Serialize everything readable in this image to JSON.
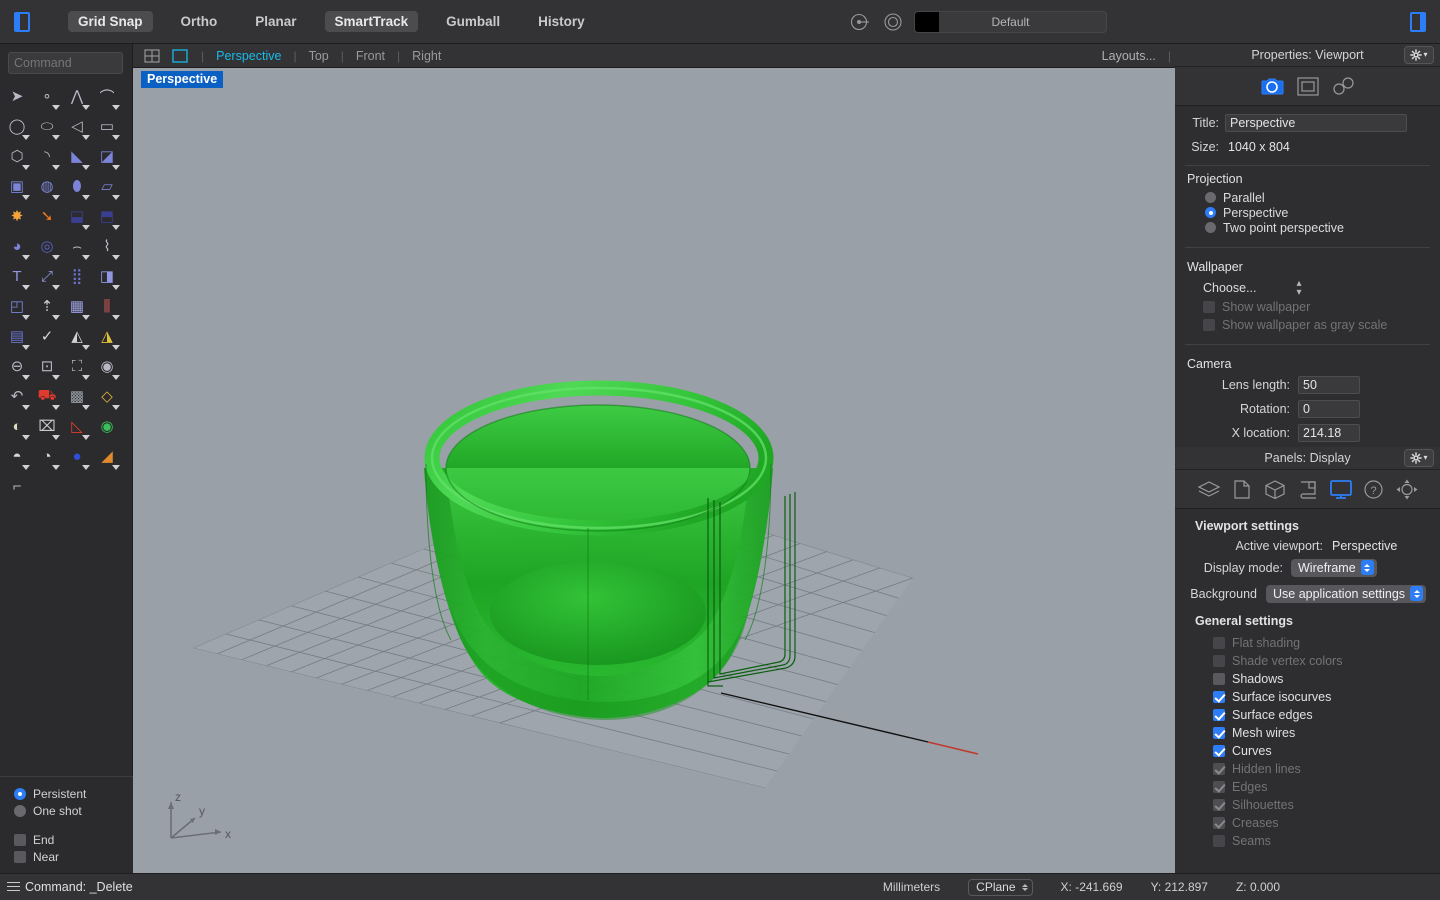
{
  "topbar": {
    "left_panel_toggle_icon": "left-panel-toggle-icon",
    "right_panel_toggle_icon": "right-panel-toggle-icon",
    "toggles": [
      {
        "label": "Grid Snap",
        "active": true
      },
      {
        "label": "Ortho",
        "active": false
      },
      {
        "label": "Planar",
        "active": false
      },
      {
        "label": "SmartTrack",
        "active": true
      },
      {
        "label": "Gumball",
        "active": false
      },
      {
        "label": "History",
        "active": false
      }
    ],
    "layer_icon": "layer-icon",
    "target-icon": "target-icon",
    "layer_color_hex": "#000000",
    "layer_name": "Default"
  },
  "command": {
    "placeholder": "Command"
  },
  "left_toolbar": {
    "tools": [
      "select-arrow-icon",
      "point-icon",
      "polyline-icon",
      "arc-icon",
      "circle-icon",
      "ellipse-icon",
      "curve-icon",
      "rectangle-icon",
      "polygon-icon",
      "fillet-curve-icon",
      "surface-corner-icon",
      "surface-edge-icon",
      "box-icon",
      "sphere-icon",
      "cylinder-icon",
      "surface-plane-icon",
      "explode-icon",
      "boolean-arrow-icon",
      "extrude-offset-icon",
      "extrude-straight-icon",
      "boolean-union-icon",
      "boolean-difference-icon",
      "blend-curve-icon",
      "array-curve-icon",
      "text-icon",
      "scale-icon",
      "array-icon",
      "mirror-icon",
      "solid-edit-icon",
      "point-array-icon",
      "grid-array-icon",
      "gumball-icon",
      "book-icon",
      "check-icon",
      "mesh-icon",
      "paint-icon",
      "zoom-out-icon",
      "zoom-window-icon",
      "zoom-extents-icon",
      "zoom-selected-icon",
      "undo-view-icon",
      "car-icon",
      "cplane-icon",
      "select-objects-icon",
      "light-icon",
      "lock-icon",
      "layers-icon",
      "color-wheel-icon",
      "render-icon",
      "render-grid-icon",
      "render-blue-icon",
      "render-cone-icon",
      "dimension-icon"
    ]
  },
  "osnap": {
    "modes": [
      {
        "label": "Persistent",
        "selected": true
      },
      {
        "label": "One shot",
        "selected": false
      }
    ],
    "snaps": [
      {
        "label": "End",
        "checked": false
      },
      {
        "label": "Near",
        "checked": false
      }
    ]
  },
  "viewport_tabs": {
    "four_view_icon": "four-view-icon",
    "single_view_icon": "single-view-icon",
    "tabs": [
      {
        "label": "Perspective",
        "active": true
      },
      {
        "label": "Top",
        "active": false
      },
      {
        "label": "Front",
        "active": false
      },
      {
        "label": "Right",
        "active": false
      }
    ],
    "layouts_label": "Layouts..."
  },
  "viewport": {
    "title": "Perspective",
    "axis_labels": {
      "x": "x",
      "y": "y",
      "z": "z"
    },
    "model_description": "green-translucent-cup",
    "model_color_hex": "#1faa25",
    "background_hex": "#9aa0a8"
  },
  "properties_panel": {
    "header": "Properties: Viewport",
    "gear_icon": "gear-dropdown-icon",
    "tab_icons": [
      "camera-icon",
      "viewport-icon",
      "link-icon"
    ],
    "title_label": "Title:",
    "title_value": "Perspective",
    "size_label": "Size:",
    "size_value": "1040 x 804",
    "projection": {
      "heading": "Projection",
      "options": [
        {
          "label": "Parallel",
          "selected": false
        },
        {
          "label": "Perspective",
          "selected": true
        },
        {
          "label": "Two point perspective",
          "selected": false
        }
      ]
    },
    "wallpaper": {
      "heading": "Wallpaper",
      "choose_label": "Choose...",
      "checkboxes": [
        {
          "label": "Show wallpaper",
          "checked": false,
          "disabled": true
        },
        {
          "label": "Show wallpaper as gray scale",
          "checked": false,
          "disabled": true
        }
      ]
    },
    "camera": {
      "heading": "Camera",
      "fields": [
        {
          "label": "Lens length:",
          "value": "50"
        },
        {
          "label": "Rotation:",
          "value": "0"
        },
        {
          "label": "X location:",
          "value": "214.18"
        }
      ]
    }
  },
  "display_panel": {
    "header": "Panels: Display",
    "gear_icon": "gear-dropdown-icon",
    "tab_icons": [
      "layers-panel-icon",
      "notes-panel-icon",
      "object-panel-icon",
      "render-panel-icon",
      "display-panel-icon",
      "help-panel-icon",
      "navigation-panel-icon"
    ],
    "viewport_settings": {
      "heading": "Viewport settings",
      "active_viewport_label": "Active viewport:",
      "active_viewport_value": "Perspective",
      "display_mode_label": "Display mode:",
      "display_mode_value": "Wireframe",
      "background_label": "Background",
      "background_value": "Use application settings"
    },
    "general_settings": {
      "heading": "General settings",
      "items": [
        {
          "label": "Flat shading",
          "checked": false,
          "disabled": true
        },
        {
          "label": "Shade vertex colors",
          "checked": false,
          "disabled": true
        },
        {
          "label": "Shadows",
          "checked": false,
          "disabled": false
        },
        {
          "label": "Surface isocurves",
          "checked": true,
          "disabled": false
        },
        {
          "label": "Surface edges",
          "checked": true,
          "disabled": false
        },
        {
          "label": "Mesh wires",
          "checked": true,
          "disabled": false
        },
        {
          "label": "Curves",
          "checked": true,
          "disabled": false
        },
        {
          "label": "Hidden lines",
          "checked": true,
          "disabled": true
        },
        {
          "label": "Edges",
          "checked": true,
          "disabled": true
        },
        {
          "label": "Silhouettes",
          "checked": true,
          "disabled": true
        },
        {
          "label": "Creases",
          "checked": true,
          "disabled": true
        },
        {
          "label": "Seams",
          "checked": false,
          "disabled": true
        }
      ]
    }
  },
  "statusbar": {
    "menu_icon": "hamburger-icon",
    "command_text": "Command: _Delete",
    "units": "Millimeters",
    "cplane": "CPlane",
    "x": "X: -241.669",
    "y": "Y: 212.897",
    "z": "Z: 0.000"
  }
}
